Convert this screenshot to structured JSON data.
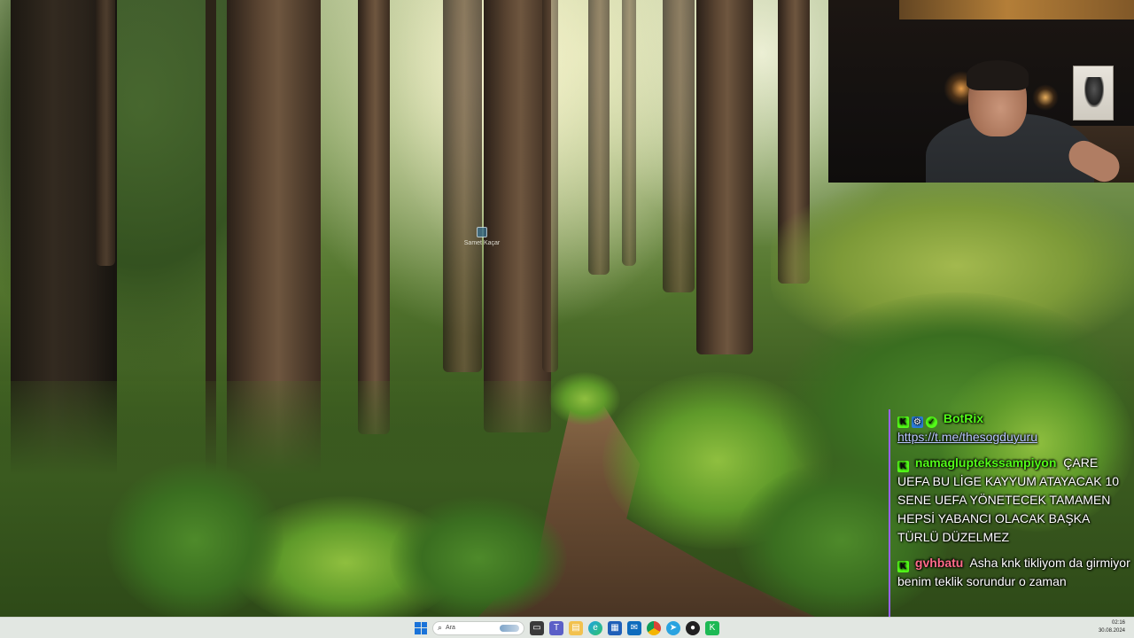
{
  "desktop": {
    "icon_label": "Samet Kaçar"
  },
  "chat": {
    "messages": [
      {
        "user": "BotRix",
        "user_color": "#53fc18",
        "badges": [
          "kick-icon",
          "bot-icon",
          "verified-icon"
        ],
        "text": "https://t.me/thesogduyuru",
        "is_link": true
      },
      {
        "user": "namagluptekssampiyon",
        "user_color": "#53fc18",
        "badges": [
          "kick-icon"
        ],
        "text": "ÇARE UEFA BU LİGE KAYYUM ATAYACAK 10 SENE UEFA YÖNETECEK TAMAMEN HEPSİ YABANCI OLACAK BAŞKA TÜRLÜ DÜZELMEZ"
      },
      {
        "user": "gvhbatu",
        "user_color": "#ff6b8a",
        "badges": [
          "kick-icon"
        ],
        "text": "Asha knk tikliyom da girmiyor benim teklik sorundur o zaman"
      }
    ],
    "accent_color": "#9a62ff"
  },
  "taskbar": {
    "search_placeholder": "Ara",
    "apps": [
      "windows-start-icon",
      "task-view-icon",
      "teams-icon",
      "file-explorer-icon",
      "edge-icon",
      "store-icon",
      "mail-icon",
      "chrome-icon",
      "telegram-icon",
      "obs-icon",
      "kick-app-icon"
    ],
    "time": "02:16",
    "date": "30.08.2024"
  }
}
